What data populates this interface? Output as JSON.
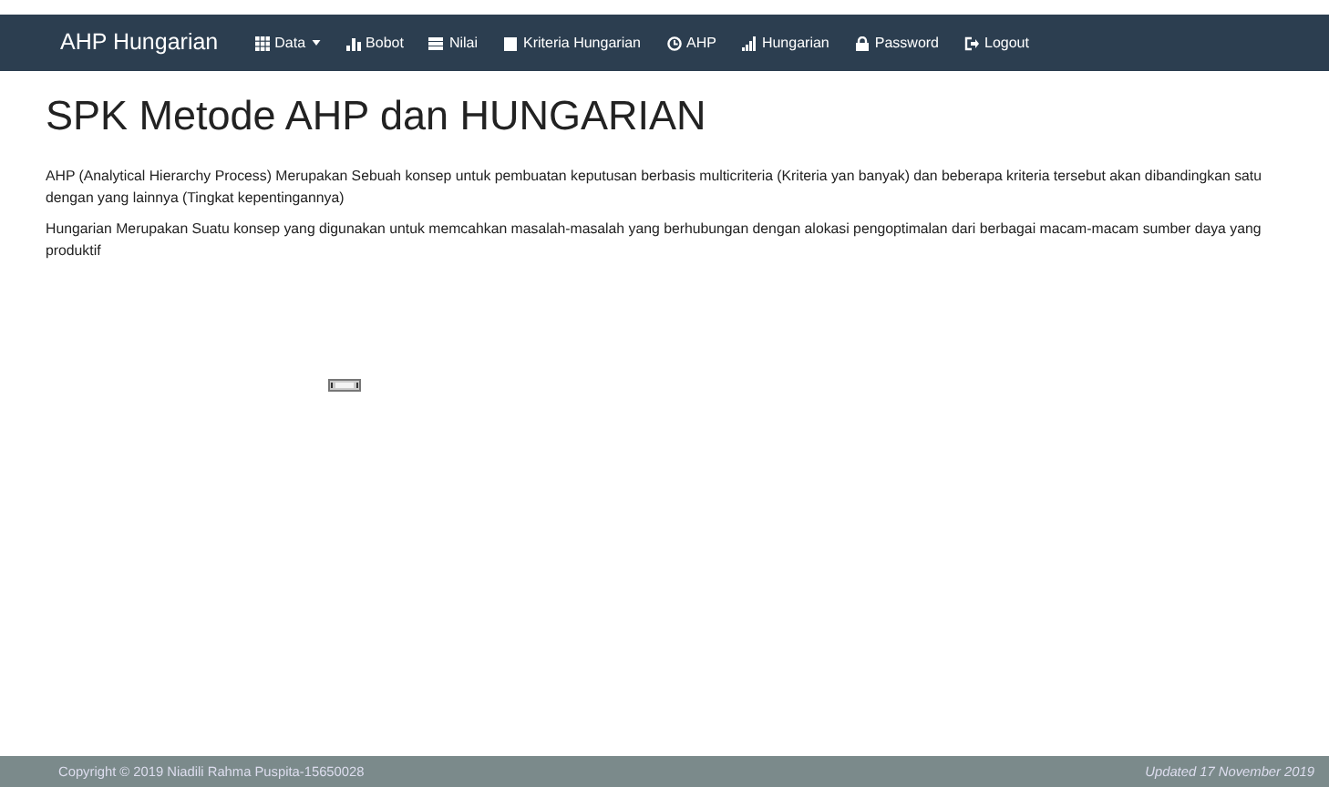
{
  "navbar": {
    "brand": "AHP Hungarian",
    "items": [
      {
        "label": "Data",
        "dropdown": true
      },
      {
        "label": "Bobot",
        "dropdown": false
      },
      {
        "label": "Nilai",
        "dropdown": false
      },
      {
        "label": "Kriteria Hungarian",
        "dropdown": false
      },
      {
        "label": "AHP",
        "dropdown": false
      },
      {
        "label": "Hungarian",
        "dropdown": false
      },
      {
        "label": "Password",
        "dropdown": false
      },
      {
        "label": "Logout",
        "dropdown": false
      }
    ]
  },
  "title": "SPK Metode AHP dan HUNGARIAN",
  "paragraphs": [
    "AHP (Analytical Hierarchy Process) Merupakan Sebuah konsep untuk pembuatan keputusan berbasis multicriteria (Kriteria yan banyak) dan beberapa kriteria tersebut akan dibandingkan satu dengan yang lainnya (Tingkat kepentingannya)",
    "Hungarian Merupakan Suatu konsep yang digunakan untuk memcahkan masalah-masalah yang berhubungan dengan alokasi pengoptimalan dari berbagai macam-macam sumber daya yang produktif"
  ],
  "footer": {
    "copyright": "Copyright © 2019 Niadili Rahma Puspita-15650028",
    "updated": "Updated 17 November 2019"
  }
}
